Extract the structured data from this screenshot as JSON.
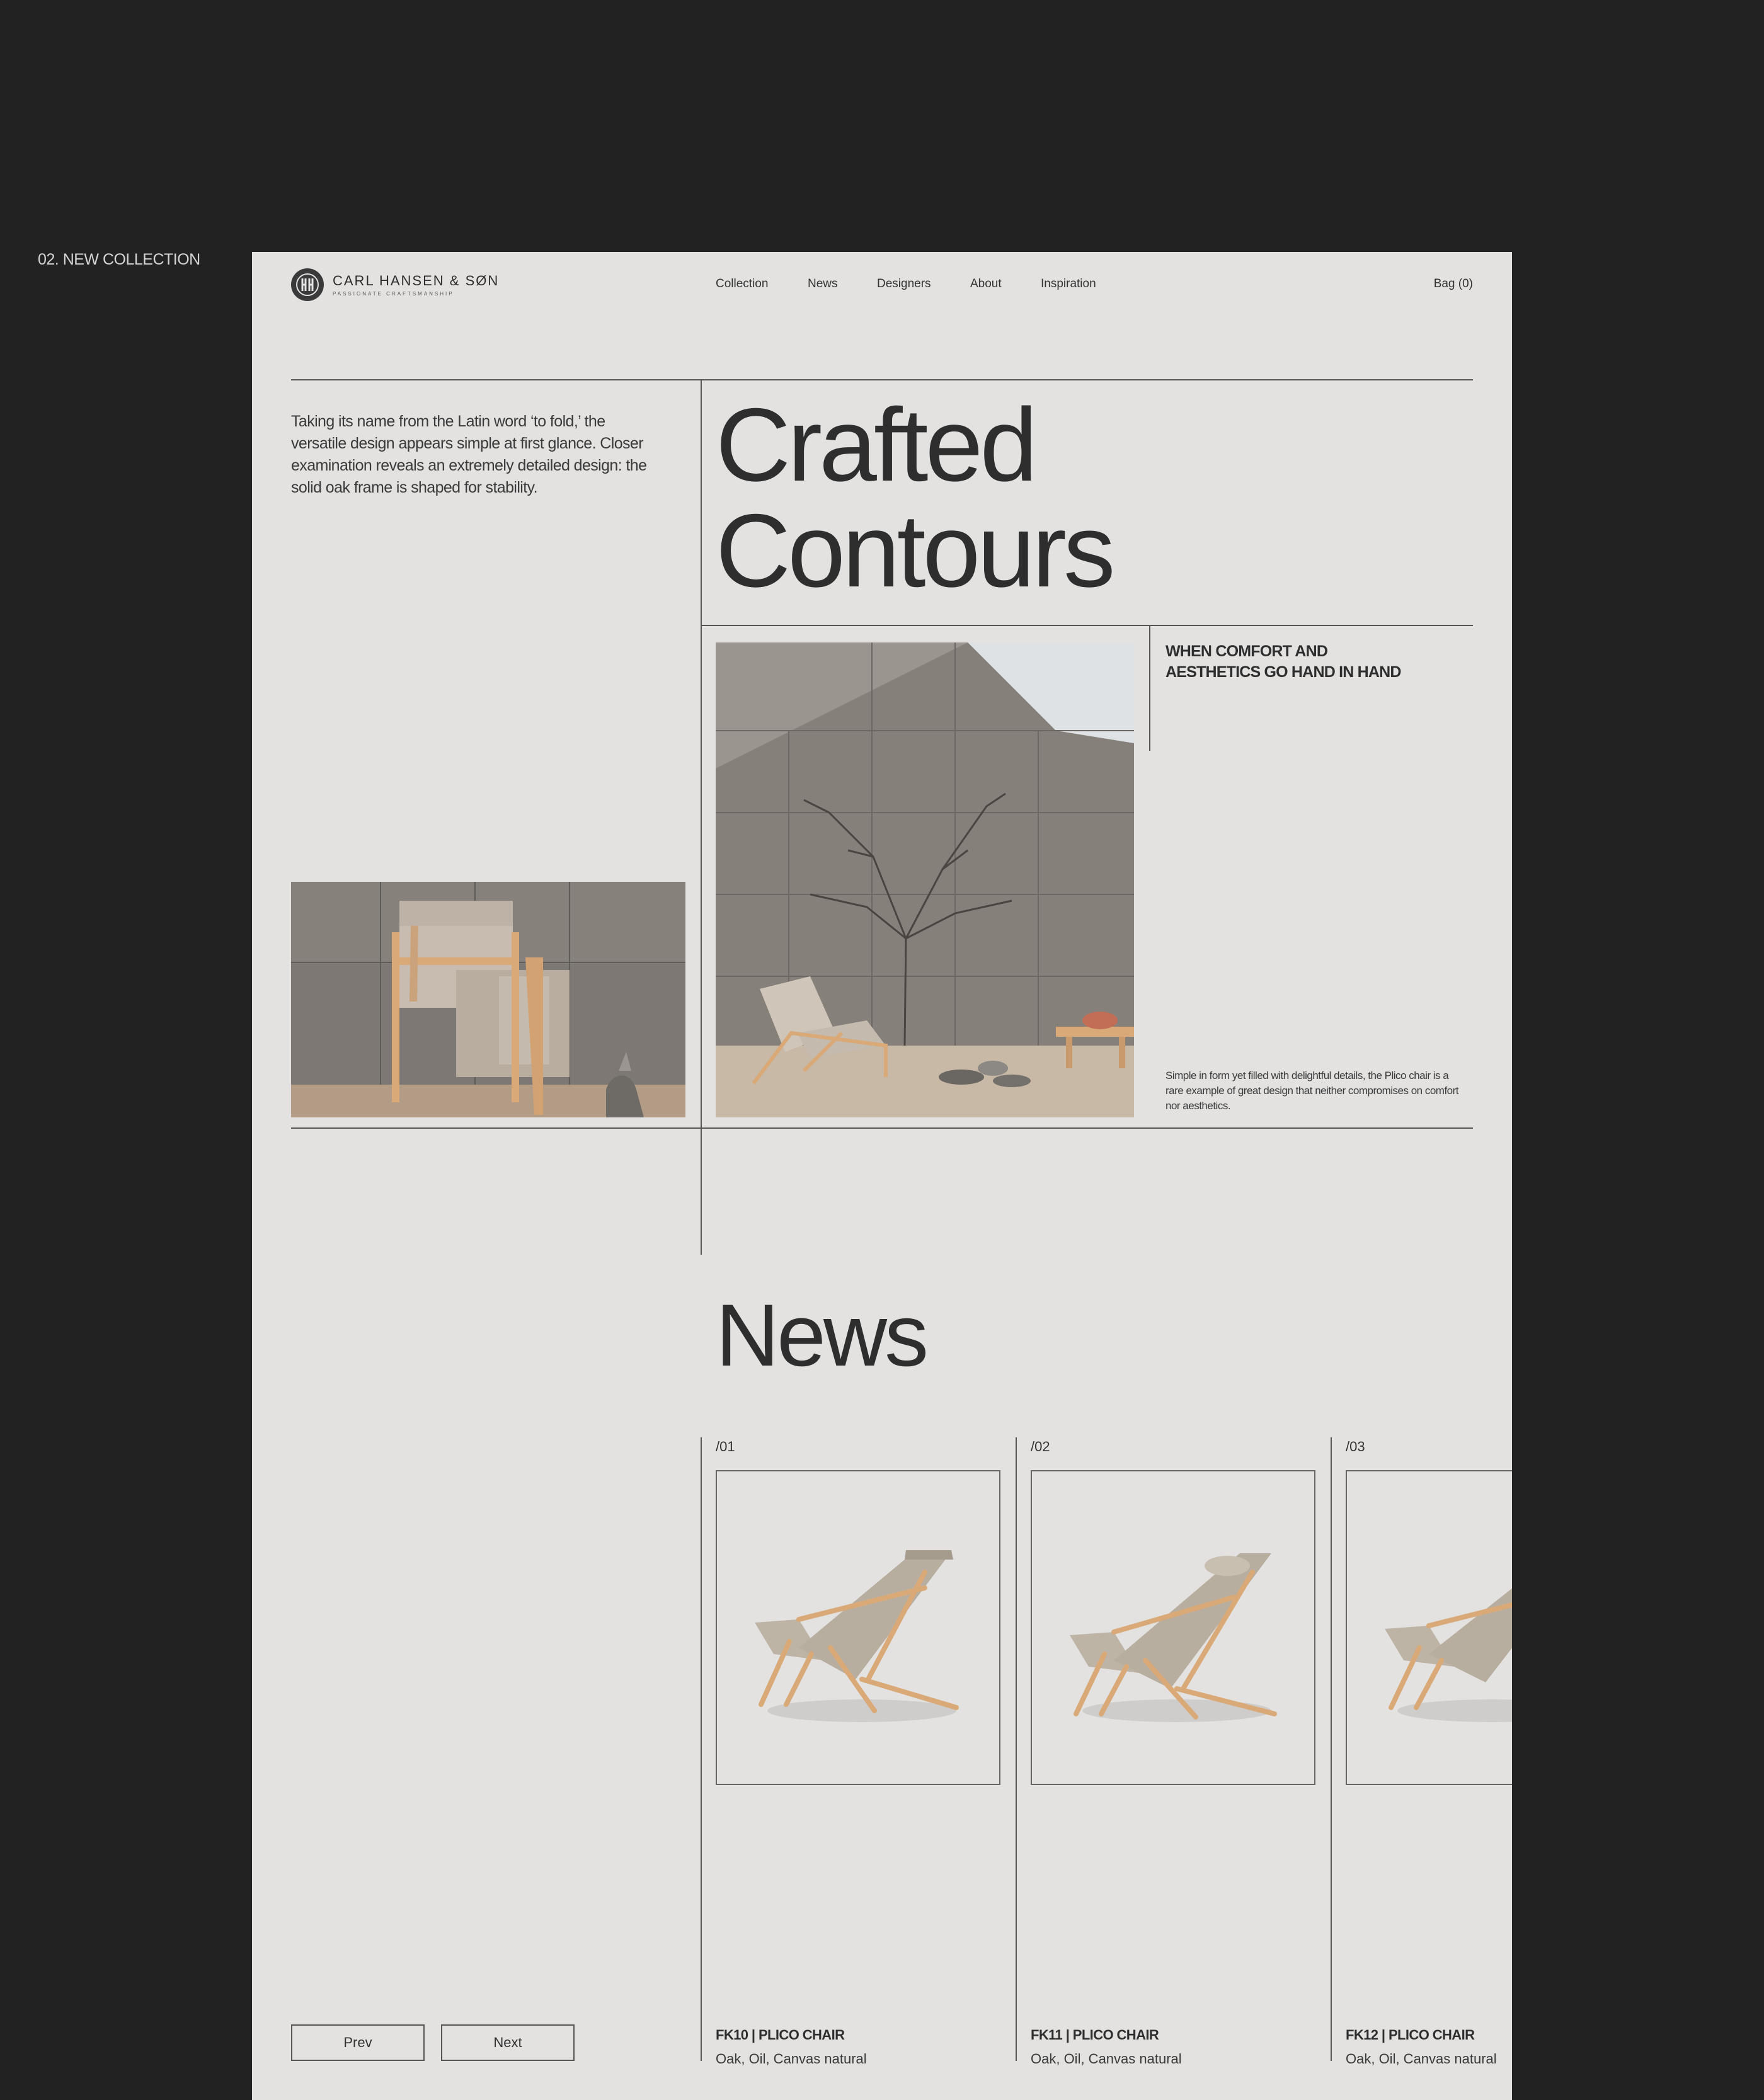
{
  "section_label": "02. NEW COLLECTION",
  "header": {
    "brand_name": "CARL HANSEN & SØN",
    "brand_tagline": "PASSIONATE CRAFTSMANSHIP",
    "nav": [
      "Collection",
      "News",
      "Designers",
      "About",
      "Inspiration"
    ],
    "bag": "Bag (0)"
  },
  "hero": {
    "intro": "Taking its name from the Latin word ‘to fold,’ the versatile design appears simple at first glance. Closer examination reveals an extremely detailed design: the solid oak frame is shaped for stability.",
    "title_line1": "Crafted",
    "title_line2": "Contours",
    "subhead_line1": "WHEN COMFORT AND",
    "subhead_line2": "AESTHETICS GO HAND IN HAND",
    "body": "Simple in form yet filled with delightful details, the Plico chair is a rare example of great design that neither compromises on comfort nor aesthetics."
  },
  "news": {
    "title": "News",
    "cards": [
      {
        "index": "/01",
        "title": "FK10 | PLICO CHAIR",
        "subtitle": "Oak, Oil, Canvas natural"
      },
      {
        "index": "/02",
        "title": "FK11 | PLICO CHAIR",
        "subtitle": "Oak, Oil, Canvas natural"
      },
      {
        "index": "/03",
        "title": "FK12 | PLICO CHAIR",
        "subtitle": "Oak, Oil, Canvas natural"
      }
    ],
    "prev": "Prev",
    "next": "Next"
  },
  "colors": {
    "outer_background": "#222222",
    "page_background": "#e3e2e1",
    "text": "#2e2e2e",
    "oak": "#d9aa78",
    "canvas": "#bdb4a6",
    "concrete": "#8a8580"
  }
}
